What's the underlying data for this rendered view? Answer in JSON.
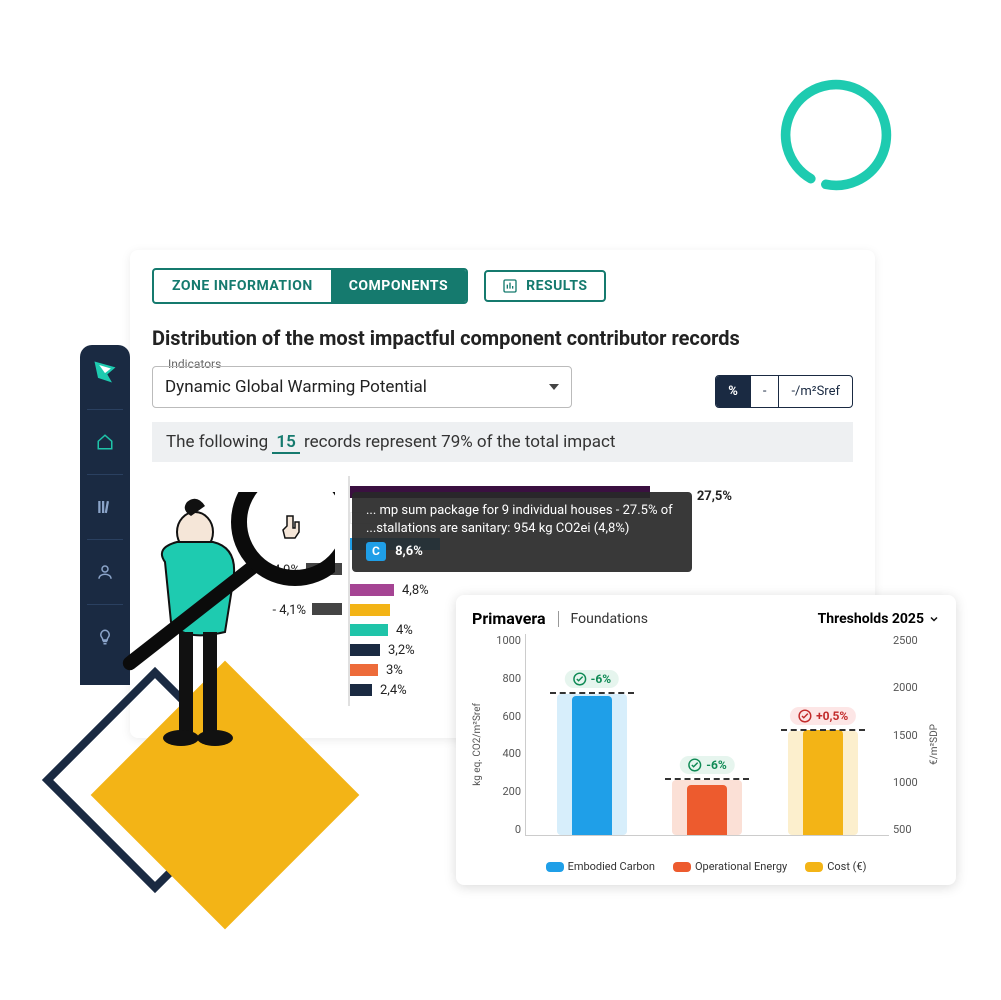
{
  "tabs": {
    "zone": "ZONE INFORMATION",
    "components": "COMPONENTS",
    "results": "RESULTS"
  },
  "section_title": "Distribution of the most impactful component contributor records",
  "indicator": {
    "label": "Indicators",
    "value": "Dynamic Global Warming Potential"
  },
  "unit_toggle": {
    "percent": "%",
    "dash": "-",
    "sref": "-/m²Sref"
  },
  "summary": {
    "prefix": "The following ",
    "count": "15",
    "suffix": " records represent 79% of the total impact"
  },
  "tooltip": {
    "pct_top": "27,5%",
    "line": "... mp sum package for 9 individual houses - 27.5% of ...stallations are sanitary: 954 kg CO2ei (4,8%)",
    "badge": "C",
    "pct": "8,6%"
  },
  "bars": [
    {
      "label": "- 4,9%",
      "neg": 36,
      "pos": 0,
      "color": "#1a2a42"
    },
    {
      "label": "",
      "neg": 0,
      "pos": 44,
      "color": "#a54493",
      "val": "4,8%"
    },
    {
      "label": "- 4,1%",
      "neg": 30,
      "pos": 40,
      "color": "#f3b416",
      "val": ""
    },
    {
      "label": "",
      "neg": 0,
      "pos": 38,
      "color": "#1fc4a9",
      "val": "4%"
    },
    {
      "label": "",
      "neg": 0,
      "pos": 30,
      "color": "#1a2a42",
      "val": "3,2%"
    },
    {
      "label": "",
      "neg": 0,
      "pos": 28,
      "color": "#ed6b3a",
      "val": "3%"
    },
    {
      "label": "",
      "neg": 0,
      "pos": 22,
      "color": "#1a2a42",
      "val": "2,4%"
    }
  ],
  "chart_card": {
    "title": "Primavera",
    "subtitle": "Foundations",
    "threshold_label": "Thresholds 2025",
    "y_left_label": "kg eq. CO2/m²Sref",
    "y_right_label": "€/m²SDP",
    "legend": {
      "embodied": "Embodied Carbon",
      "operational": "Operational Energy",
      "cost": "Cost (€)"
    }
  },
  "chart_data": {
    "type": "bar",
    "title": "Primavera — Foundations",
    "y_left": {
      "label": "kg eq. CO2/m²Sref",
      "ticks": [
        0,
        200,
        400,
        600,
        800,
        1000
      ],
      "ylim": [
        0,
        1000
      ]
    },
    "y_right": {
      "label": "€/m²SDP",
      "ticks": [
        500,
        1000,
        1500,
        2000,
        2500
      ],
      "ylim": [
        0,
        2500
      ]
    },
    "series": [
      {
        "name": "Embodied Carbon",
        "axis": "left",
        "value": 690,
        "threshold": 700,
        "delta": "-6%",
        "delta_status": "good",
        "color": "#1f9fe8",
        "bg": "#d7eefb"
      },
      {
        "name": "Operational Energy",
        "axis": "left",
        "value": 250,
        "threshold": 275,
        "delta": "-6%",
        "delta_status": "good",
        "color": "#ed5b2e",
        "bg": "#fbe0d6"
      },
      {
        "name": "Cost (€)",
        "axis": "right",
        "value": 1300,
        "threshold": 1290,
        "delta": "+0,5%",
        "delta_status": "bad",
        "color": "#f3b416",
        "bg": "#fcefcd"
      }
    ]
  }
}
